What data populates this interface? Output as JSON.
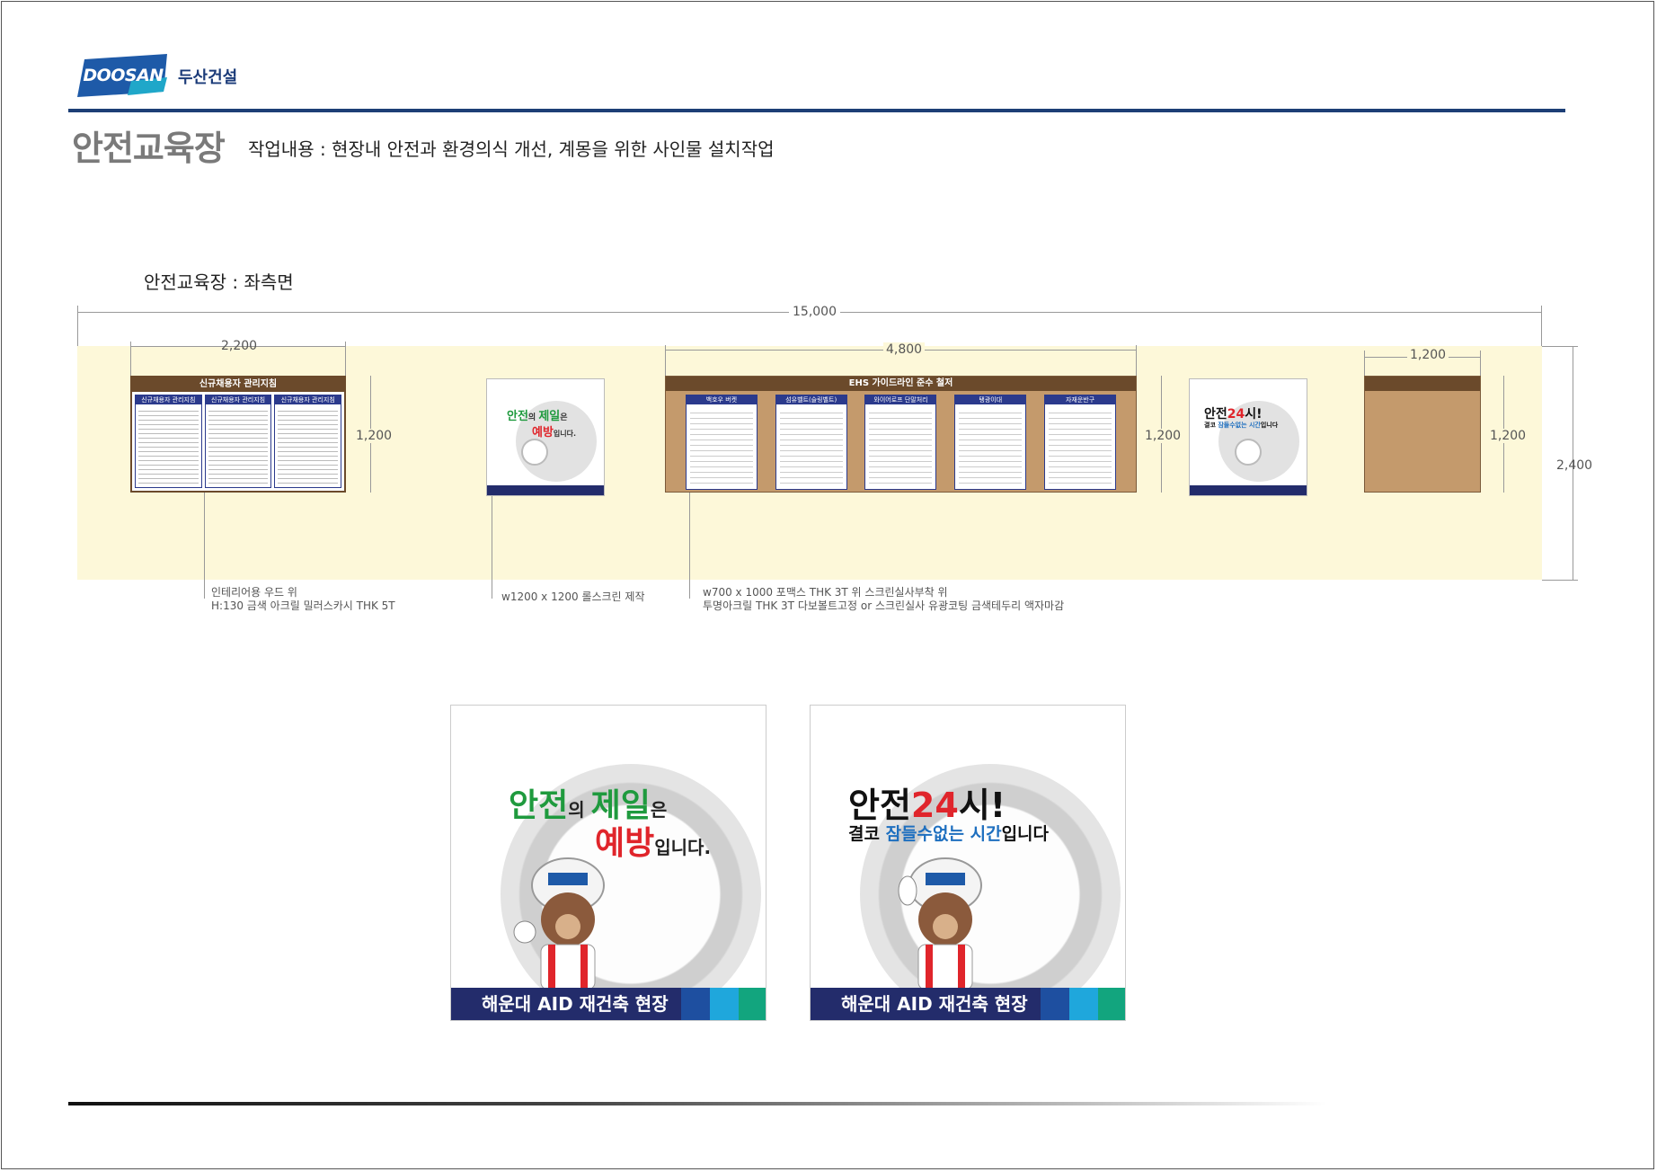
{
  "header": {
    "logo_text": "DOOSAN",
    "company": "두산건설",
    "title": "안전교육장",
    "description": "작업내용 : 현장내 안전과 환경의식 개선, 계몽을 위한 사인물 설치작업"
  },
  "section_label": "안전교육장 : 좌측면",
  "dimensions": {
    "total_width": "15,000",
    "board_a_width": "2,200",
    "board_b_width": "4,800",
    "board_c_width": "1,200",
    "height_1200": "1,200",
    "height_2400": "2,400"
  },
  "board_a": {
    "header": "신규채용자 관리지침",
    "columns": [
      "신규채용자 관리지침",
      "신규채용자 관리지침",
      "신규채용자 관리지침"
    ]
  },
  "board_b": {
    "header": "EHS 가이드라인 준수 철저",
    "columns": [
      "백호우 버켓",
      "섬유벨트(슬링벨트)",
      "와이어로프 단말처리",
      "탱광이대",
      "자재운반구"
    ]
  },
  "notes": {
    "note_a_line1": "인테리어용 우드 위",
    "note_a_line2": "H:130 금색 아크릴 밀러스카시 THK 5T",
    "note_b": "w1200 x 1200 롤스크린 제작",
    "note_c_line1": "w700 x 1000 포맥스 THK 3T 위 스크린실사부착 위",
    "note_c_line2": "투명아크릴 THK 3T 다보볼트고정 or 스크린실사 유광코팅 금색테두리 액자마감"
  },
  "poster_1": {
    "line1_a": "안전",
    "line1_b": "의 ",
    "line1_c": "제일",
    "line1_d": "은",
    "line2_a": "예방",
    "line2_b": "입니다.",
    "footer": "해운대 AID 재건축 현장"
  },
  "poster_2": {
    "line1_a": "안전",
    "line1_b": "24",
    "line1_c": "시!",
    "line2_a": "결코 ",
    "line2_b": "잠들수없는 ",
    "line2_c": "시간",
    "line2_d": "입니다",
    "footer": "해운대 AID 재건축 현장"
  },
  "colors": {
    "brand_navy": "#1d3f76",
    "footer_navy": "#232c6b",
    "wood": "#c49a6c",
    "wall": "#fdf8d9",
    "green": "#1f9a3e",
    "red": "#e0252b",
    "blue": "#1e6fbf"
  }
}
